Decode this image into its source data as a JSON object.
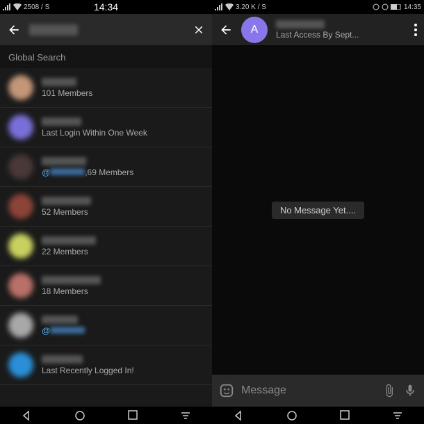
{
  "left": {
    "status": {
      "net": "2508 / S",
      "time": "14:34"
    },
    "search_placeholder": "",
    "section_label": "Global Search",
    "items": [
      {
        "avatar_color": "#c49678",
        "sub": "101 Members"
      },
      {
        "avatar_color": "#7a6fd8",
        "sub": "Last Login Within One Week"
      },
      {
        "avatar_color": "#4a3838",
        "sub_prefix": "@",
        "sub_suffix": ",69 Members"
      },
      {
        "avatar_color": "#8b4438",
        "sub": "52 Members"
      },
      {
        "avatar_color": "#c8d060",
        "sub": "22 Members"
      },
      {
        "avatar_color": "#b87068",
        "sub": "18 Members"
      },
      {
        "avatar_color": "#a8a8a8",
        "sub_prefix": "@"
      },
      {
        "avatar_color": "#2a8fd8",
        "sub": "Last Recently Logged In!"
      }
    ]
  },
  "right": {
    "status": {
      "net": "3.20 K / S",
      "time": "14:35"
    },
    "chat": {
      "avatar_letter": "A",
      "status": "Last Access By Sept..."
    },
    "empty_message": "No Message Yet....",
    "input_placeholder": "Message"
  }
}
